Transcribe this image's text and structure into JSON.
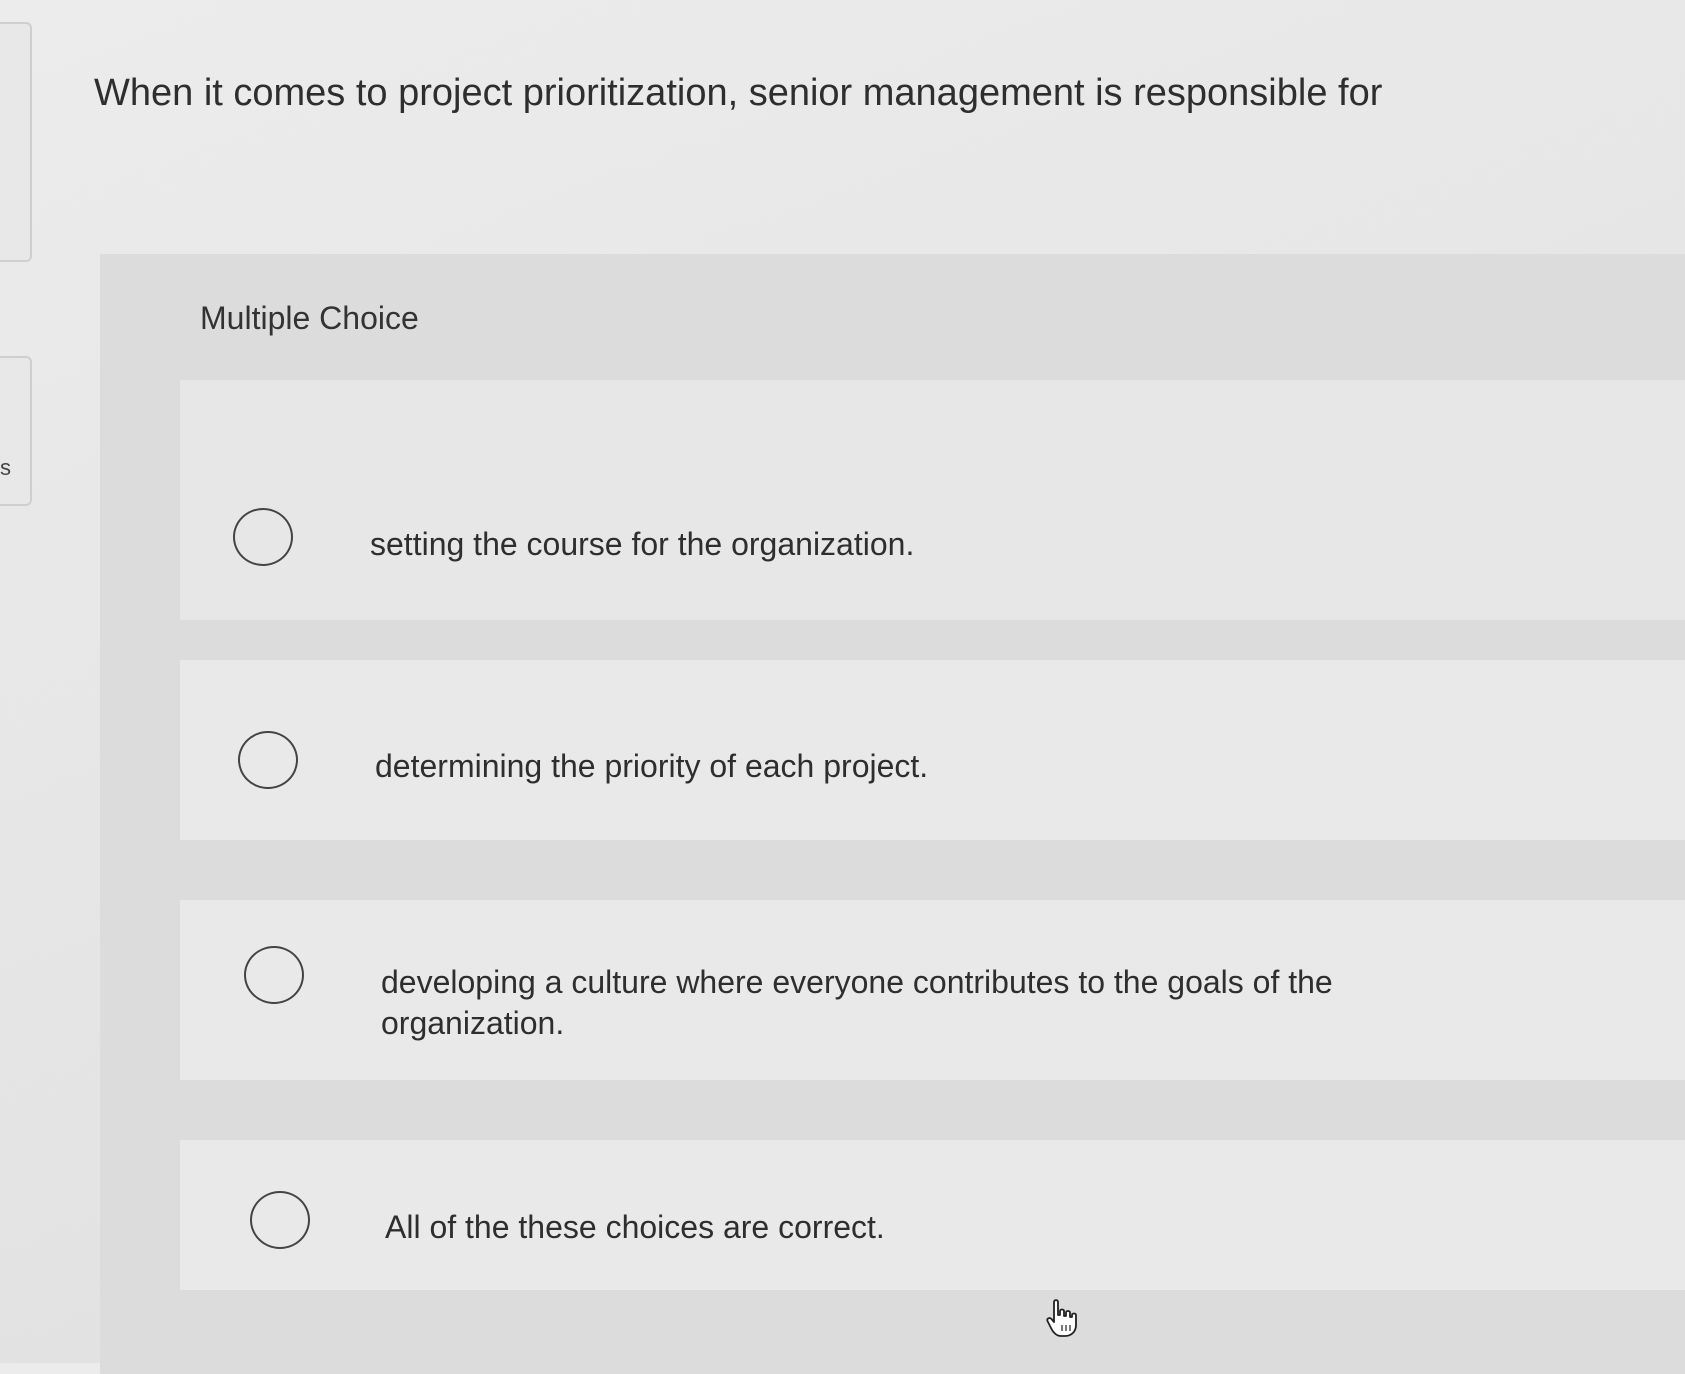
{
  "side_tab": {
    "letter": "s"
  },
  "question": {
    "text": "When it comes to project prioritization, senior management is responsible for"
  },
  "multiple_choice": {
    "label": "Multiple Choice",
    "choices": [
      {
        "text": "setting the course for the organization.",
        "selected": false
      },
      {
        "text": "determining the priority of each project.",
        "selected": false
      },
      {
        "text": "developing a culture where everyone contributes to the goals of the organization.",
        "selected": false
      },
      {
        "text": "All of the these choices are correct.",
        "selected": false
      }
    ]
  },
  "cursor": {
    "icon": "hand-pointer-icon"
  }
}
